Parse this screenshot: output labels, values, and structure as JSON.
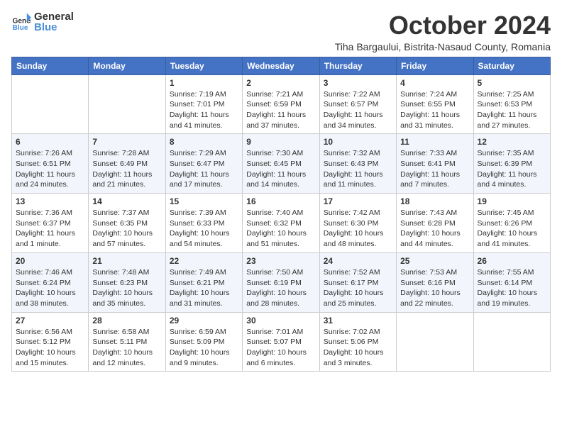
{
  "header": {
    "logo_general": "General",
    "logo_blue": "Blue",
    "title": "October 2024",
    "subtitle": "Tiha Bargaului, Bistrita-Nasaud County, Romania"
  },
  "days_of_week": [
    "Sunday",
    "Monday",
    "Tuesday",
    "Wednesday",
    "Thursday",
    "Friday",
    "Saturday"
  ],
  "weeks": [
    [
      {
        "day": "",
        "info": ""
      },
      {
        "day": "",
        "info": ""
      },
      {
        "day": "1",
        "info": "Sunrise: 7:19 AM\nSunset: 7:01 PM\nDaylight: 11 hours and 41 minutes."
      },
      {
        "day": "2",
        "info": "Sunrise: 7:21 AM\nSunset: 6:59 PM\nDaylight: 11 hours and 37 minutes."
      },
      {
        "day": "3",
        "info": "Sunrise: 7:22 AM\nSunset: 6:57 PM\nDaylight: 11 hours and 34 minutes."
      },
      {
        "day": "4",
        "info": "Sunrise: 7:24 AM\nSunset: 6:55 PM\nDaylight: 11 hours and 31 minutes."
      },
      {
        "day": "5",
        "info": "Sunrise: 7:25 AM\nSunset: 6:53 PM\nDaylight: 11 hours and 27 minutes."
      }
    ],
    [
      {
        "day": "6",
        "info": "Sunrise: 7:26 AM\nSunset: 6:51 PM\nDaylight: 11 hours and 24 minutes."
      },
      {
        "day": "7",
        "info": "Sunrise: 7:28 AM\nSunset: 6:49 PM\nDaylight: 11 hours and 21 minutes."
      },
      {
        "day": "8",
        "info": "Sunrise: 7:29 AM\nSunset: 6:47 PM\nDaylight: 11 hours and 17 minutes."
      },
      {
        "day": "9",
        "info": "Sunrise: 7:30 AM\nSunset: 6:45 PM\nDaylight: 11 hours and 14 minutes."
      },
      {
        "day": "10",
        "info": "Sunrise: 7:32 AM\nSunset: 6:43 PM\nDaylight: 11 hours and 11 minutes."
      },
      {
        "day": "11",
        "info": "Sunrise: 7:33 AM\nSunset: 6:41 PM\nDaylight: 11 hours and 7 minutes."
      },
      {
        "day": "12",
        "info": "Sunrise: 7:35 AM\nSunset: 6:39 PM\nDaylight: 11 hours and 4 minutes."
      }
    ],
    [
      {
        "day": "13",
        "info": "Sunrise: 7:36 AM\nSunset: 6:37 PM\nDaylight: 11 hours and 1 minute."
      },
      {
        "day": "14",
        "info": "Sunrise: 7:37 AM\nSunset: 6:35 PM\nDaylight: 10 hours and 57 minutes."
      },
      {
        "day": "15",
        "info": "Sunrise: 7:39 AM\nSunset: 6:33 PM\nDaylight: 10 hours and 54 minutes."
      },
      {
        "day": "16",
        "info": "Sunrise: 7:40 AM\nSunset: 6:32 PM\nDaylight: 10 hours and 51 minutes."
      },
      {
        "day": "17",
        "info": "Sunrise: 7:42 AM\nSunset: 6:30 PM\nDaylight: 10 hours and 48 minutes."
      },
      {
        "day": "18",
        "info": "Sunrise: 7:43 AM\nSunset: 6:28 PM\nDaylight: 10 hours and 44 minutes."
      },
      {
        "day": "19",
        "info": "Sunrise: 7:45 AM\nSunset: 6:26 PM\nDaylight: 10 hours and 41 minutes."
      }
    ],
    [
      {
        "day": "20",
        "info": "Sunrise: 7:46 AM\nSunset: 6:24 PM\nDaylight: 10 hours and 38 minutes."
      },
      {
        "day": "21",
        "info": "Sunrise: 7:48 AM\nSunset: 6:23 PM\nDaylight: 10 hours and 35 minutes."
      },
      {
        "day": "22",
        "info": "Sunrise: 7:49 AM\nSunset: 6:21 PM\nDaylight: 10 hours and 31 minutes."
      },
      {
        "day": "23",
        "info": "Sunrise: 7:50 AM\nSunset: 6:19 PM\nDaylight: 10 hours and 28 minutes."
      },
      {
        "day": "24",
        "info": "Sunrise: 7:52 AM\nSunset: 6:17 PM\nDaylight: 10 hours and 25 minutes."
      },
      {
        "day": "25",
        "info": "Sunrise: 7:53 AM\nSunset: 6:16 PM\nDaylight: 10 hours and 22 minutes."
      },
      {
        "day": "26",
        "info": "Sunrise: 7:55 AM\nSunset: 6:14 PM\nDaylight: 10 hours and 19 minutes."
      }
    ],
    [
      {
        "day": "27",
        "info": "Sunrise: 6:56 AM\nSunset: 5:12 PM\nDaylight: 10 hours and 15 minutes."
      },
      {
        "day": "28",
        "info": "Sunrise: 6:58 AM\nSunset: 5:11 PM\nDaylight: 10 hours and 12 minutes."
      },
      {
        "day": "29",
        "info": "Sunrise: 6:59 AM\nSunset: 5:09 PM\nDaylight: 10 hours and 9 minutes."
      },
      {
        "day": "30",
        "info": "Sunrise: 7:01 AM\nSunset: 5:07 PM\nDaylight: 10 hours and 6 minutes."
      },
      {
        "day": "31",
        "info": "Sunrise: 7:02 AM\nSunset: 5:06 PM\nDaylight: 10 hours and 3 minutes."
      },
      {
        "day": "",
        "info": ""
      },
      {
        "day": "",
        "info": ""
      }
    ]
  ]
}
